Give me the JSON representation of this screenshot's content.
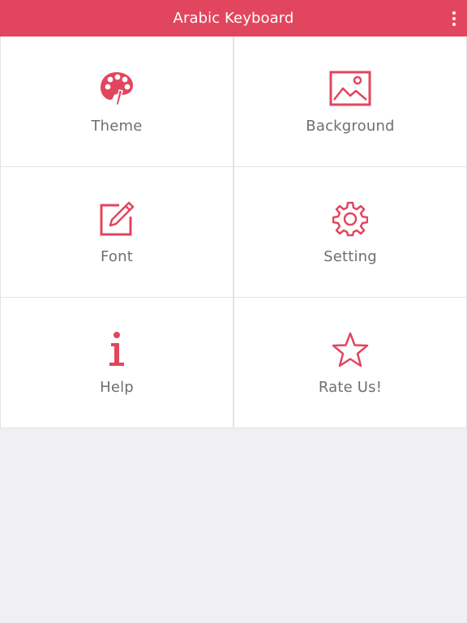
{
  "app": {
    "title": "Arabic Keyboard",
    "accent_color": "#e2465e",
    "menu_icon": "more-vertical-icon"
  },
  "tiles": [
    {
      "label": "Theme",
      "icon": "palette-icon"
    },
    {
      "label": "Background",
      "icon": "image-icon"
    },
    {
      "label": "Font",
      "icon": "edit-icon"
    },
    {
      "label": "Setting",
      "icon": "gear-icon"
    },
    {
      "label": "Help",
      "icon": "info-icon"
    },
    {
      "label": "Rate Us!",
      "icon": "star-icon"
    }
  ]
}
